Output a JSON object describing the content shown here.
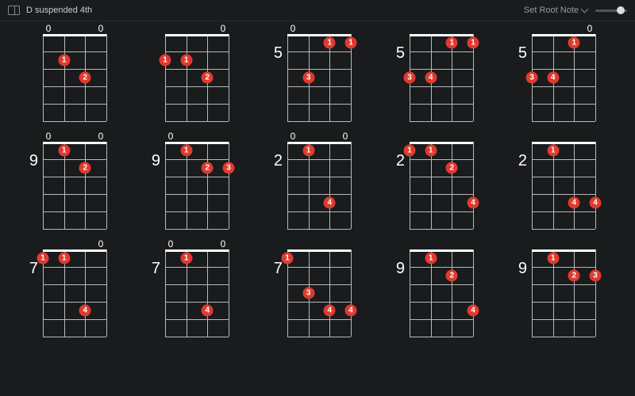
{
  "header": {
    "title": "D suspended 4th",
    "root_note_label": "Set Root Note",
    "slider_value": 0.8
  },
  "layout": {
    "strings": 4,
    "frets": 5
  },
  "chart_data": {
    "type": "table",
    "note": "Ukulele chord diagrams (4 strings, 5 frets shown). 'open' marks strings played open (0). 'dots' are [string(1-4), fret(1-5), finger].",
    "chords": [
      {
        "position": "",
        "open": [
          1,
          4
        ],
        "dots": [
          [
            2,
            2,
            1
          ],
          [
            3,
            3,
            2
          ]
        ]
      },
      {
        "position": "",
        "open": [
          4
        ],
        "dots": [
          [
            1,
            2,
            1
          ],
          [
            2,
            2,
            1
          ],
          [
            3,
            3,
            2
          ]
        ]
      },
      {
        "position": "5",
        "open": [
          1
        ],
        "dots": [
          [
            3,
            1,
            1
          ],
          [
            4,
            1,
            1
          ],
          [
            2,
            3,
            3
          ]
        ]
      },
      {
        "position": "5",
        "open": [],
        "dots": [
          [
            3,
            1,
            1
          ],
          [
            4,
            1,
            1
          ],
          [
            1,
            3,
            3
          ],
          [
            2,
            3,
            4
          ]
        ]
      },
      {
        "position": "5",
        "open": [
          4
        ],
        "dots": [
          [
            3,
            1,
            1
          ],
          [
            1,
            3,
            3
          ],
          [
            2,
            3,
            4
          ]
        ]
      },
      {
        "position": "9",
        "open": [
          1,
          4
        ],
        "dots": [
          [
            2,
            1,
            1
          ],
          [
            3,
            2,
            2
          ]
        ]
      },
      {
        "position": "9",
        "open": [
          1
        ],
        "dots": [
          [
            2,
            1,
            1
          ],
          [
            3,
            2,
            2
          ],
          [
            4,
            2,
            3
          ]
        ]
      },
      {
        "position": "2",
        "open": [
          1,
          4
        ],
        "dots": [
          [
            2,
            1,
            1
          ],
          [
            3,
            4,
            4
          ]
        ]
      },
      {
        "position": "2",
        "open": [],
        "dots": [
          [
            1,
            1,
            1
          ],
          [
            2,
            1,
            1
          ],
          [
            3,
            2,
            2
          ],
          [
            4,
            4,
            4
          ]
        ]
      },
      {
        "position": "2",
        "open": [],
        "dots": [
          [
            2,
            1,
            1
          ],
          [
            3,
            4,
            4
          ],
          [
            4,
            4,
            4
          ]
        ]
      },
      {
        "position": "7",
        "open": [
          4
        ],
        "dots": [
          [
            1,
            1,
            1
          ],
          [
            2,
            1,
            1
          ],
          [
            3,
            4,
            4
          ]
        ]
      },
      {
        "position": "7",
        "open": [
          1,
          4
        ],
        "dots": [
          [
            2,
            1,
            1
          ],
          [
            3,
            4,
            4
          ]
        ]
      },
      {
        "position": "7",
        "open": [],
        "dots": [
          [
            1,
            1,
            1
          ],
          [
            2,
            3,
            3
          ],
          [
            3,
            4,
            4
          ],
          [
            4,
            4,
            4
          ]
        ]
      },
      {
        "position": "9",
        "open": [],
        "dots": [
          [
            2,
            1,
            1
          ],
          [
            3,
            2,
            2
          ],
          [
            4,
            4,
            4
          ]
        ]
      },
      {
        "position": "9",
        "open": [],
        "dots": [
          [
            2,
            1,
            1
          ],
          [
            3,
            2,
            2
          ],
          [
            4,
            2,
            3
          ]
        ]
      }
    ]
  }
}
